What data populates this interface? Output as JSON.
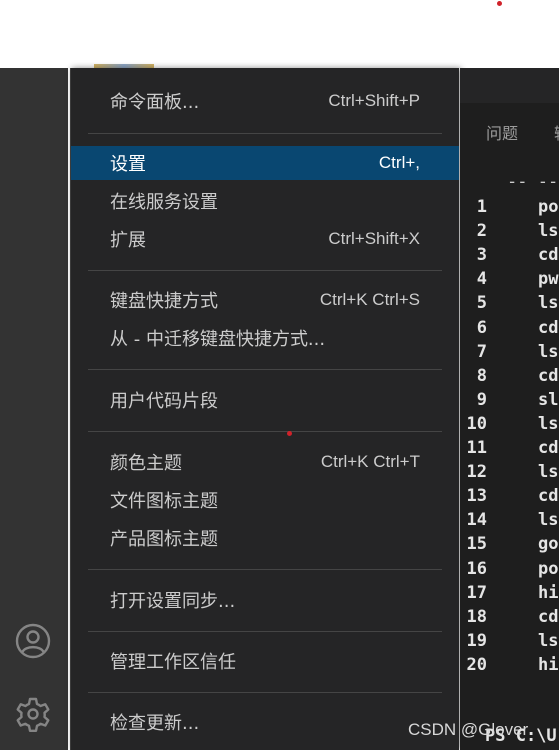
{
  "menu": {
    "items": [
      {
        "label": "命令面板...",
        "shortcut": "Ctrl+Shift+P"
      },
      {
        "label": "设置",
        "shortcut": "Ctrl+,"
      },
      {
        "label": "在线服务设置",
        "shortcut": ""
      },
      {
        "label": "扩展",
        "shortcut": "Ctrl+Shift+X"
      },
      {
        "label": "键盘快捷方式",
        "shortcut": "Ctrl+K Ctrl+S"
      },
      {
        "label": "从 - 中迁移键盘快捷方式...",
        "shortcut": ""
      },
      {
        "label": "用户代码片段",
        "shortcut": ""
      },
      {
        "label": "颜色主题",
        "shortcut": "Ctrl+K Ctrl+T"
      },
      {
        "label": "文件图标主题",
        "shortcut": ""
      },
      {
        "label": "产品图标主题",
        "shortcut": ""
      },
      {
        "label": "打开设置同步...",
        "shortcut": ""
      },
      {
        "label": "管理工作区信任",
        "shortcut": ""
      },
      {
        "label": "检查更新...",
        "shortcut": ""
      }
    ],
    "selected_index": 1
  },
  "panel": {
    "tabs": [
      {
        "label": "问题"
      },
      {
        "label": "输"
      }
    ]
  },
  "terminal": {
    "header_dashes": "-- --",
    "history": [
      {
        "num": "1",
        "cmd": "po"
      },
      {
        "num": "2",
        "cmd": "ls"
      },
      {
        "num": "3",
        "cmd": "cd"
      },
      {
        "num": "4",
        "cmd": "pw"
      },
      {
        "num": "5",
        "cmd": "ls"
      },
      {
        "num": "6",
        "cmd": "cd"
      },
      {
        "num": "7",
        "cmd": "ls"
      },
      {
        "num": "8",
        "cmd": "cd"
      },
      {
        "num": "9",
        "cmd": "sl"
      },
      {
        "num": "10",
        "cmd": "ls"
      },
      {
        "num": "11",
        "cmd": "cd"
      },
      {
        "num": "12",
        "cmd": "ls"
      },
      {
        "num": "13",
        "cmd": "cd"
      },
      {
        "num": "14",
        "cmd": "ls"
      },
      {
        "num": "15",
        "cmd": "go"
      },
      {
        "num": "16",
        "cmd": "po"
      },
      {
        "num": "17",
        "cmd": "hi"
      },
      {
        "num": "18",
        "cmd": "cd"
      },
      {
        "num": "19",
        "cmd": "ls"
      },
      {
        "num": "20",
        "cmd": "hi"
      }
    ],
    "prompt": "PS C:\\U"
  },
  "watermark": "CSDN @Glover",
  "activity_bar": {
    "icons": [
      "account-icon",
      "gear-icon"
    ]
  },
  "colors": {
    "selected_bg": "#094771",
    "menu_bg": "#252526",
    "activity_bg": "#333333",
    "terminal_bg": "#1e1e1e"
  }
}
